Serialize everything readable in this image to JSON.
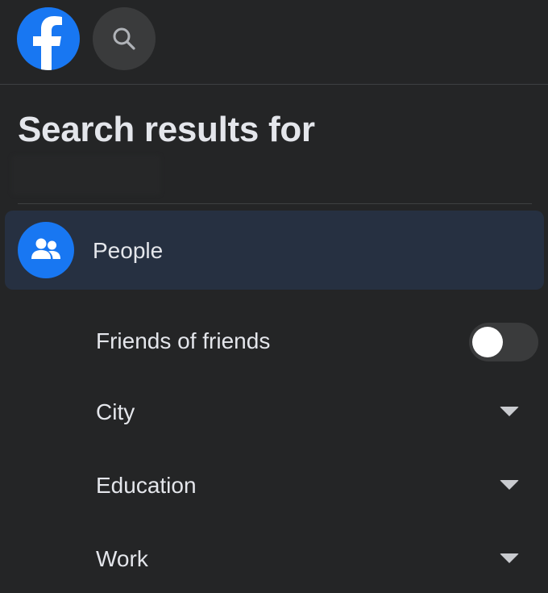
{
  "header": {
    "logo_icon": "facebook-logo-icon",
    "search_icon": "search-icon",
    "brand_color": "#1877f2"
  },
  "results": {
    "heading": "Search results for"
  },
  "category": {
    "label": "People",
    "icon": "people-icon",
    "selected": true
  },
  "filters": {
    "friends_of_friends": {
      "label": "Friends of friends",
      "enabled": false
    },
    "city": {
      "label": "City"
    },
    "education": {
      "label": "Education"
    },
    "work": {
      "label": "Work"
    }
  }
}
